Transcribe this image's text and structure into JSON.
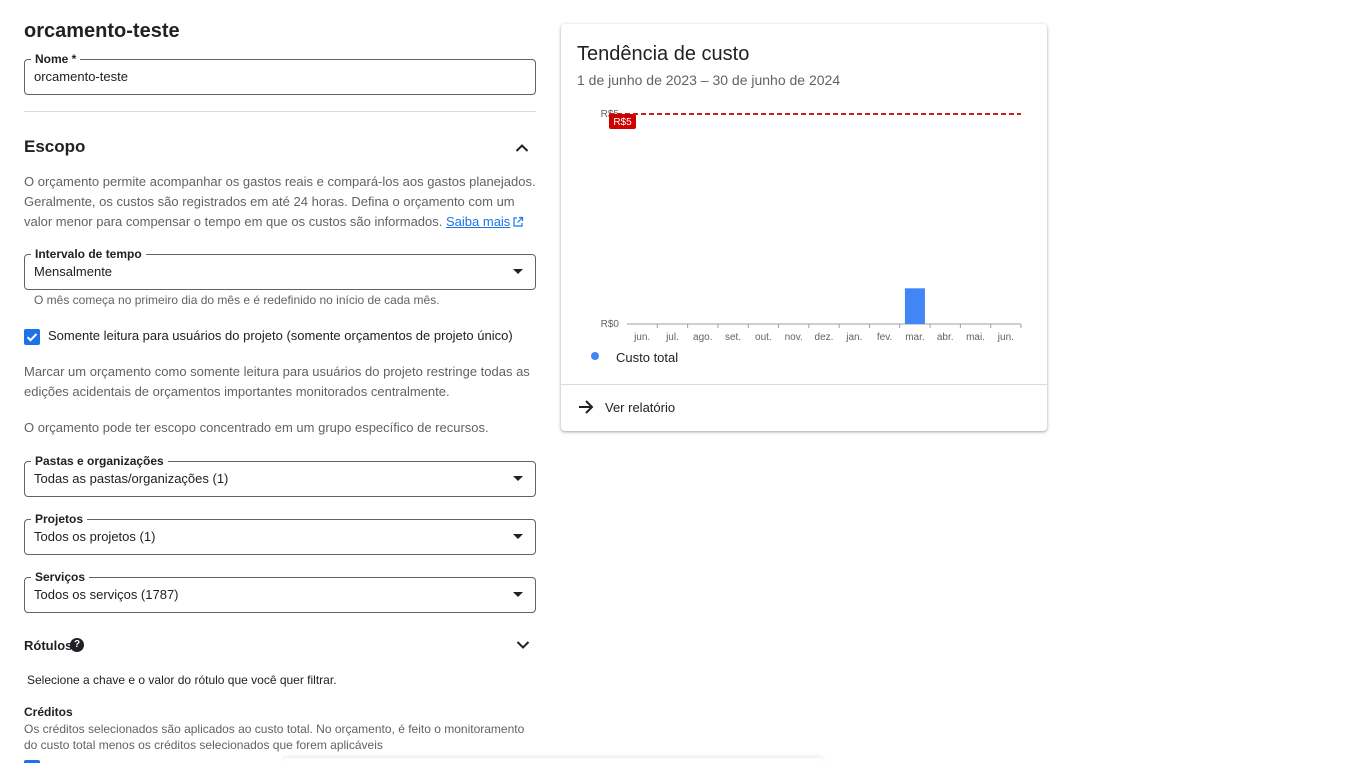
{
  "page": {
    "title": "orcamento-teste"
  },
  "name_field": {
    "label": "Nome *",
    "value": "orcamento-teste"
  },
  "scope": {
    "heading": "Escopo",
    "description": "O orçamento permite acompanhar os gastos reais e compará-los aos gastos planejados. Geralmente, os custos são registrados em até 24 horas. Defina o orçamento com um valor menor para compensar o tempo em que os custos são informados.",
    "learn_more": "Saiba mais",
    "time_range": {
      "label": "Intervalo de tempo",
      "value": "Mensalmente",
      "helper": "O mês começa no primeiro dia do mês e é redefinido no início de cada mês."
    },
    "readonly_checkbox": {
      "label": "Somente leitura para usuários do projeto (somente orçamentos de projeto único)",
      "checked": true
    },
    "readonly_description": "Marcar um orçamento como somente leitura para usuários do projeto restringe todas as edições acidentais de orçamentos importantes monitorados centralmente.",
    "resources_description": "O orçamento pode ter escopo concentrado em um grupo específico de recursos.",
    "folders": {
      "label": "Pastas e organizações",
      "value": "Todas as pastas/organizações (1)"
    },
    "projects": {
      "label": "Projetos",
      "value": "Todos os projetos (1)"
    },
    "services": {
      "label": "Serviços",
      "value": "Todos os serviços (1787)"
    },
    "labels": {
      "heading": "Rótulos",
      "help_icon": "help-icon",
      "description": "Selecione a chave e o valor do rótulo que você quer filtrar."
    },
    "credits": {
      "heading": "Créditos",
      "description": "Os créditos selecionados são aplicados ao custo total. No orçamento, é feito o monitoramento do custo total menos os créditos selecionados que forem aplicáveis"
    }
  },
  "card": {
    "title": "Tendência de custo",
    "subtitle": "1 de junho de 2023 – 30 de junho de 2024",
    "legend": "Custo total",
    "report_link": "Ver relatório"
  },
  "colors": {
    "accent": "#1a73e8",
    "bar": "#4285f4",
    "budget_line": "#c5221f"
  },
  "chart_data": {
    "type": "bar",
    "categories": [
      "jun.",
      "jul.",
      "ago.",
      "set.",
      "out.",
      "nov.",
      "dez.",
      "jan.",
      "fev.",
      "mar.",
      "abr.",
      "mai.",
      "jun."
    ],
    "series": [
      {
        "name": "Custo total",
        "values": [
          0,
          0,
          0,
          0,
          0,
          0,
          0,
          0,
          0,
          0.85,
          0,
          0,
          0
        ]
      }
    ],
    "budget": 5,
    "budget_label": "R$5",
    "y_ticks": [
      "R$0",
      "R$5"
    ],
    "ylim": [
      0,
      5
    ],
    "title": "",
    "xlabel": "",
    "ylabel": "",
    "legend_position": "bottom-left"
  }
}
